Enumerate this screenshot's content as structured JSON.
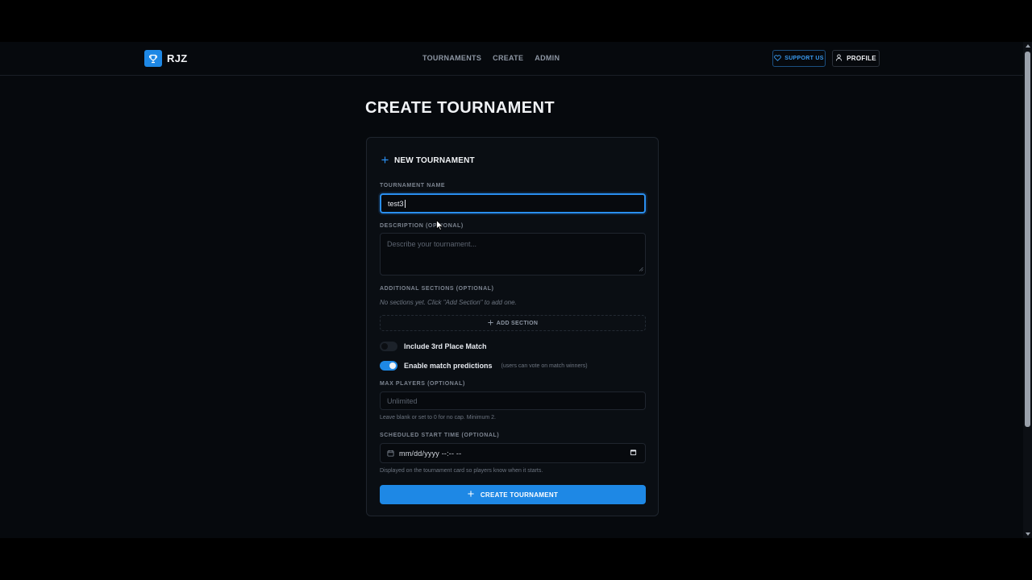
{
  "header": {
    "logo_text": "RJZ",
    "nav": [
      "TOURNAMENTS",
      "CREATE",
      "ADMIN"
    ],
    "support_label": "SUPPORT US",
    "profile_label": "PROFILE"
  },
  "page": {
    "title": "CREATE TOURNAMENT"
  },
  "card": {
    "title": "NEW TOURNAMENT",
    "name_label": "TOURNAMENT NAME",
    "name_value": "test3",
    "description_label": "DESCRIPTION (OPTIONAL)",
    "description_placeholder": "Describe your tournament...",
    "sections_label": "ADDITIONAL SECTIONS (OPTIONAL)",
    "sections_empty": "No sections yet. Click \"Add Section\" to add one.",
    "add_section_label": "ADD SECTION",
    "third_place_label": "Include 3rd Place Match",
    "third_place_enabled": false,
    "predictions_label": "Enable match predictions",
    "predictions_note": "(users can vote on match winners)",
    "predictions_enabled": true,
    "max_players_label": "MAX PLAYERS (OPTIONAL)",
    "max_players_placeholder": "Unlimited",
    "max_players_help": "Leave blank or set to 0 for no cap. Minimum 2.",
    "start_time_label": "SCHEDULED START TIME (OPTIONAL)",
    "start_time_value": "mm/dd/yyyy --:-- --",
    "start_time_help": "Displayed on the tournament card so players know when it starts.",
    "submit_label": "CREATE TOURNAMENT"
  },
  "colors": {
    "accent": "#1e88e5",
    "background": "#06090d",
    "card": "#0a0e13"
  }
}
